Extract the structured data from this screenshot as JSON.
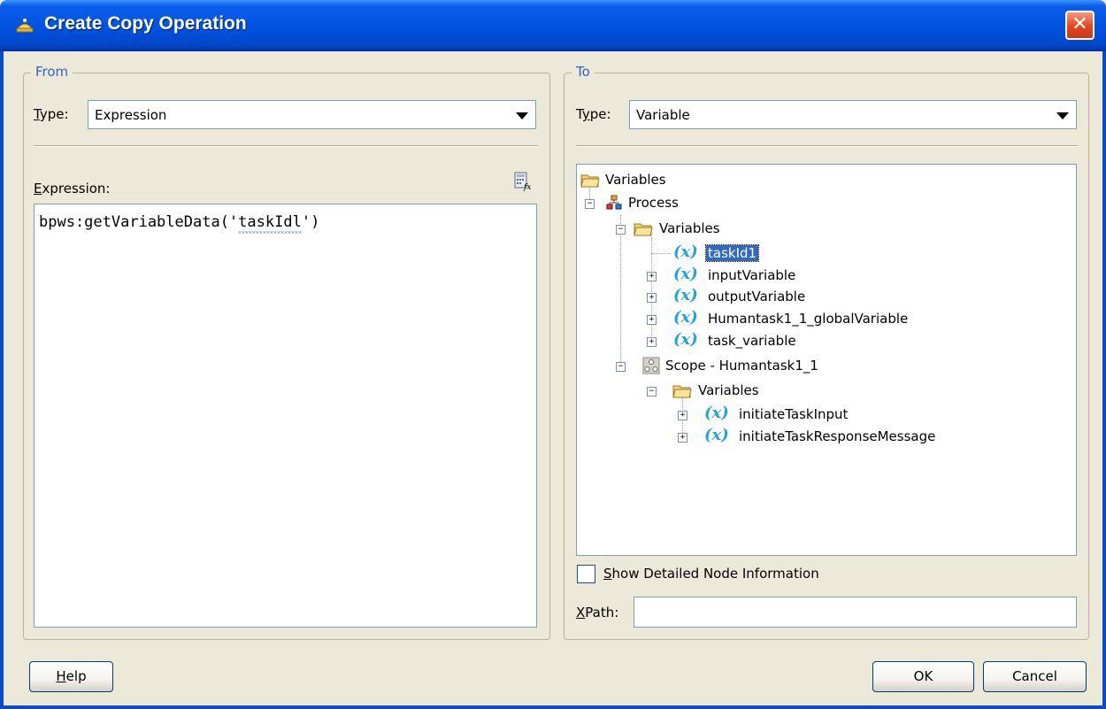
{
  "window": {
    "title": "Create Copy Operation",
    "close_glyph": "✕"
  },
  "from": {
    "legend": "From",
    "type_label": "Type:",
    "type_value": "Expression",
    "expression_label": "Expression:",
    "expression_text": "bpws:getVariableData('",
    "expression_underlined": "taskIdl",
    "expression_tail": "')"
  },
  "to": {
    "legend": "To",
    "type_label": "Type:",
    "type_value": "Variable",
    "tree": [
      {
        "label": "Variables",
        "icon": "folder-icon"
      },
      {
        "label": "Process",
        "icon": "process-icon"
      },
      {
        "label": "Variables",
        "icon": "folder-icon"
      },
      {
        "label": "taskId1",
        "icon": "variable-icon",
        "selected": true
      },
      {
        "label": "inputVariable",
        "icon": "variable-icon"
      },
      {
        "label": "outputVariable",
        "icon": "variable-icon"
      },
      {
        "label": "Humantask1_1_globalVariable",
        "icon": "variable-icon"
      },
      {
        "label": "task_variable",
        "icon": "variable-icon"
      },
      {
        "label": "Scope - Humantask1_1",
        "icon": "scope-icon"
      },
      {
        "label": "Variables",
        "icon": "folder-icon"
      },
      {
        "label": "initiateTaskInput",
        "icon": "variable-icon"
      },
      {
        "label": "initiateTaskResponseMessage",
        "icon": "variable-icon"
      }
    ],
    "var_glyph": "(x)",
    "show_detailed_label": "Show Detailed Node Information",
    "show_detailed_checked": false,
    "xpath_label": "XPath:",
    "xpath_value": ""
  },
  "buttons": {
    "help": "Help",
    "ok": "OK",
    "cancel": "Cancel"
  },
  "colors": {
    "titlebar": "#0054e3",
    "selection": "#316ac5",
    "legend": "#3464c0",
    "variable_icon": "#1fa3d8"
  }
}
